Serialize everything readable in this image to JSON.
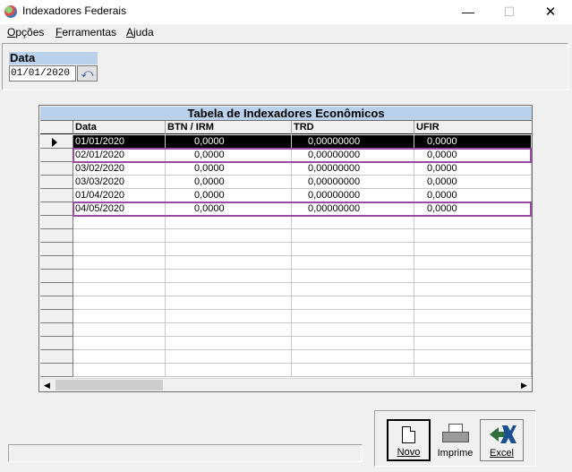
{
  "window": {
    "title": "Indexadores Federais"
  },
  "menu": [
    {
      "label": "Opções",
      "mnemonic": "O",
      "rest": "pções"
    },
    {
      "label": "Ferramentas",
      "mnemonic": "F",
      "rest": "erramentas"
    },
    {
      "label": "Ajuda",
      "mnemonic": "A",
      "rest": "juda"
    }
  ],
  "filter": {
    "label": "Data",
    "value": "01/01/2020",
    "undo_icon": "undo-icon"
  },
  "table": {
    "caption": "Tabela de Indexadores Econômicos",
    "columns": [
      "Data",
      "BTN / IRM",
      "TRD",
      "UFIR"
    ],
    "rows": [
      [
        "01/01/2020",
        "0,0000",
        "0,00000000",
        "0,0000"
      ],
      [
        "02/01/2020",
        "0,0000",
        "0,00000000",
        "0,0000"
      ],
      [
        "03/02/2020",
        "0,0000",
        "0,00000000",
        "0,0000"
      ],
      [
        "03/03/2020",
        "0,0000",
        "0,00000000",
        "0,0000"
      ],
      [
        "01/04/2020",
        "0,0000",
        "0,00000000",
        "0,0000"
      ],
      [
        "04/05/2020",
        "0,0000",
        "0,00000000",
        "0,0000"
      ]
    ],
    "selected_row": 0,
    "highlighted_rows": [
      1,
      5
    ],
    "highlight_color": "#9b4aa3"
  },
  "buttons": {
    "novo": "Novo",
    "imprime": "Imprime",
    "excel": "Excel"
  },
  "colors": {
    "caption_bg": "#b9d1ea",
    "selection_bg": "#000000"
  }
}
